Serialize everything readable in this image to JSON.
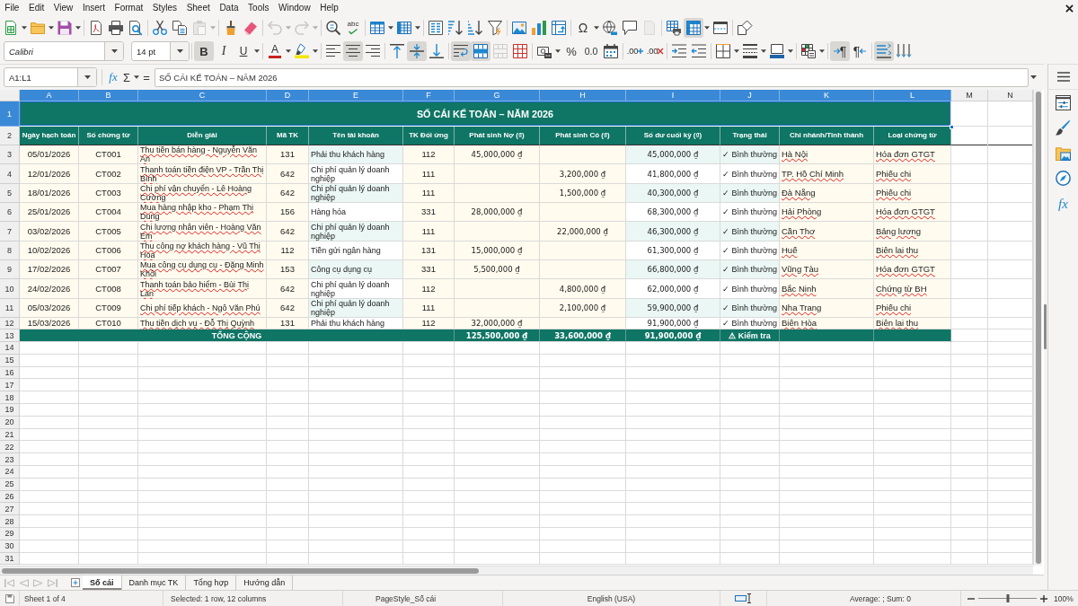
{
  "menu_bar": [
    "File",
    "Edit",
    "View",
    "Insert",
    "Format",
    "Styles",
    "Sheet",
    "Data",
    "Tools",
    "Window",
    "Help"
  ],
  "standard_toolbar": {
    "buttons": [
      {
        "pressed": false,
        "disabled": false
      },
      {
        "pressed": false,
        "disabled": false
      },
      {
        "pressed": false,
        "disabled": false
      },
      {
        "pressed": false,
        "disabled": false
      },
      {
        "pressed": false,
        "disabled": false
      },
      {
        "pressed": false,
        "disabled": false
      },
      {
        "pressed": false,
        "disabled": false
      },
      {
        "pressed": false,
        "disabled": false
      },
      {
        "pressed": false,
        "disabled": true
      },
      {
        "pressed": false,
        "disabled": false
      },
      {
        "pressed": false,
        "disabled": false
      },
      {
        "pressed": false,
        "disabled": true
      },
      {
        "pressed": false,
        "disabled": true
      },
      {
        "pressed": false,
        "disabled": false
      },
      {
        "label": "abc",
        "pressed": false,
        "disabled": false
      },
      {
        "pressed": false,
        "disabled": false
      },
      {
        "pressed": false,
        "disabled": false
      },
      {
        "pressed": false,
        "disabled": false
      },
      {
        "pressed": false,
        "disabled": false
      },
      {
        "pressed": false,
        "disabled": false
      },
      {
        "pressed": false,
        "disabled": false
      },
      {
        "pressed": false,
        "disabled": false
      },
      {
        "pressed": false,
        "disabled": false
      },
      {
        "pressed": false,
        "disabled": false
      },
      {
        "label": "Ω",
        "pressed": false,
        "disabled": false
      },
      {
        "pressed": false,
        "disabled": false
      },
      {
        "pressed": false,
        "disabled": false
      },
      {
        "pressed": false,
        "disabled": true
      },
      {
        "pressed": false,
        "disabled": false
      },
      {
        "pressed": true,
        "disabled": false
      },
      {
        "pressed": false,
        "disabled": false
      },
      {
        "pressed": false,
        "disabled": false
      }
    ]
  },
  "formatting_toolbar": {
    "font_name": "Calibri",
    "font_size": "14 pt",
    "buttons": [
      {
        "label": "B",
        "pressed": true,
        "disabled": false
      },
      {
        "label": "I",
        "pressed": false,
        "disabled": false
      },
      {
        "label": "U",
        "pressed": false,
        "disabled": false
      },
      {
        "label": "A",
        "pressed": false,
        "disabled": false
      },
      {
        "pressed": false,
        "disabled": false
      },
      {
        "pressed": false,
        "disabled": false
      },
      {
        "pressed": true,
        "disabled": false
      },
      {
        "pressed": false,
        "disabled": false
      },
      {
        "pressed": false,
        "disabled": false
      },
      {
        "pressed": true,
        "disabled": false
      },
      {
        "pressed": false,
        "disabled": false
      },
      {
        "pressed": true,
        "disabled": false
      },
      {
        "pressed": true,
        "disabled": false
      },
      {
        "pressed": false,
        "disabled": true
      },
      {
        "pressed": false,
        "disabled": false
      },
      {
        "pressed": false,
        "disabled": false
      },
      {
        "label": "%",
        "pressed": false,
        "disabled": false
      },
      {
        "label": "0.0",
        "pressed": false,
        "disabled": false
      },
      {
        "pressed": false,
        "disabled": false
      },
      {
        "label": ".00",
        "pressed": false,
        "disabled": false
      },
      {
        "label": ".00",
        "pressed": false,
        "disabled": false
      },
      {
        "pressed": false,
        "disabled": false
      },
      {
        "pressed": false,
        "disabled": false
      },
      {
        "pressed": false,
        "disabled": false
      },
      {
        "pressed": false,
        "disabled": false
      },
      {
        "pressed": false,
        "disabled": false
      },
      {
        "pressed": false,
        "disabled": false
      },
      {
        "label": "¶",
        "pressed": true,
        "disabled": false
      },
      {
        "label": "¶",
        "pressed": false,
        "disabled": false
      },
      {
        "pressed": true,
        "disabled": false
      },
      {
        "pressed": false,
        "disabled": false
      }
    ]
  },
  "formula_bar": {
    "name_box": "A1:L1",
    "function_wizard": "fx",
    "sum": "Σ",
    "formula_sign": "=",
    "content": "SỐ CÁI KẾ TOÁN – NĂM 2026"
  },
  "sheet": {
    "column_headers": [
      {
        "label": "A",
        "selected": true
      },
      {
        "label": "B",
        "selected": true
      },
      {
        "label": "C",
        "selected": true
      },
      {
        "label": "D",
        "selected": true
      },
      {
        "label": "E",
        "selected": true
      },
      {
        "label": "F",
        "selected": true
      },
      {
        "label": "G",
        "selected": true
      },
      {
        "label": "H",
        "selected": true
      },
      {
        "label": "I",
        "selected": true
      },
      {
        "label": "J",
        "selected": true
      },
      {
        "label": "K",
        "selected": true
      },
      {
        "label": "L",
        "selected": true
      },
      {
        "label": "M",
        "selected": false
      },
      {
        "label": "N",
        "selected": false
      }
    ],
    "row_headers": [
      {
        "label": "1",
        "selected": true
      },
      {
        "label": "2",
        "selected": false
      },
      {
        "label": "3",
        "selected": false
      },
      {
        "label": "4",
        "selected": false
      },
      {
        "label": "5",
        "selected": false
      },
      {
        "label": "6",
        "selected": false
      },
      {
        "label": "7",
        "selected": false
      },
      {
        "label": "8",
        "selected": false
      },
      {
        "label": "9",
        "selected": false
      },
      {
        "label": "10",
        "selected": false
      },
      {
        "label": "11",
        "selected": false
      },
      {
        "label": "12",
        "selected": false
      },
      {
        "label": "13",
        "selected": false
      },
      {
        "label": "14",
        "selected": false
      },
      {
        "label": "15",
        "selected": false
      },
      {
        "label": "16",
        "selected": false
      },
      {
        "label": "17",
        "selected": false
      },
      {
        "label": "18",
        "selected": false
      },
      {
        "label": "19",
        "selected": false
      },
      {
        "label": "20",
        "selected": false
      },
      {
        "label": "21",
        "selected": false
      },
      {
        "label": "22",
        "selected": false
      },
      {
        "label": "23",
        "selected": false
      },
      {
        "label": "24",
        "selected": false
      },
      {
        "label": "25",
        "selected": false
      },
      {
        "label": "26",
        "selected": false
      },
      {
        "label": "27",
        "selected": false
      },
      {
        "label": "28",
        "selected": false
      },
      {
        "label": "29",
        "selected": false
      },
      {
        "label": "30",
        "selected": false
      },
      {
        "label": "31",
        "selected": false
      }
    ],
    "title": {
      "text": "SỐ CÁI KẾ TOÁN – NĂM 2026",
      "selected": true
    },
    "table": {
      "columns": [
        {
          "heading": "Ngày hạch toán",
          "spell_flagged": false
        },
        {
          "heading": "Số chứng từ",
          "spell_flagged": false
        },
        {
          "heading": "Diễn giải",
          "spell_flagged": true
        },
        {
          "heading": "Mã TK",
          "spell_flagged": false
        },
        {
          "heading": "Tên tài khoản",
          "spell_flagged": false
        },
        {
          "heading": "TK Đối ứng",
          "spell_flagged": false
        },
        {
          "heading": "Phát sinh Nợ (₫)",
          "spell_flagged": false
        },
        {
          "heading": "Phát sinh Có (₫)",
          "spell_flagged": false
        },
        {
          "heading": "Số dư cuối kỳ (₫)",
          "spell_flagged": false
        },
        {
          "heading": "Trạng thái",
          "spell_flagged": false
        },
        {
          "heading": "Chi nhánh/Tỉnh thành",
          "spell_flagged": true
        },
        {
          "heading": "Loại chứng từ",
          "spell_flagged": true
        }
      ],
      "rows": [
        {
          "date": "05/01/2026",
          "voucher_no": "CT001",
          "description": "Thu tiền bán hàng - Nguyễn Văn An",
          "account": "131",
          "account_name": "Phải thu khách hàng",
          "contra_account": "112",
          "debit": "45,000,000 ₫",
          "balance": "45,000,000 ₫",
          "status": "✓ Bình thường",
          "branch": "Hà Nội",
          "voucher_type": "Hóa đơn GTGT"
        },
        {
          "date": "12/01/2026",
          "voucher_no": "CT002",
          "description": "Thanh toán tiền điện VP - Trần Thị Bình",
          "account": "642",
          "account_name": "Chi phí quản lý doanh nghiệp",
          "contra_account": "111",
          "credit": "3,200,000 ₫",
          "balance": "41,800,000 ₫",
          "status": "✓ Bình thường",
          "branch": "TP. Hồ Chí Minh",
          "voucher_type": "Phiếu chi"
        },
        {
          "date": "18/01/2026",
          "voucher_no": "CT003",
          "description": "Chi phí vận chuyển - Lê Hoàng Cường",
          "account": "642",
          "account_name": "Chi phí quản lý doanh nghiệp",
          "contra_account": "111",
          "credit": "1,500,000 ₫",
          "balance": "40,300,000 ₫",
          "status": "✓ Bình thường",
          "branch": "Đà Nẵng",
          "voucher_type": "Phiếu chi"
        },
        {
          "date": "25/01/2026",
          "voucher_no": "CT004",
          "description": "Mua hàng nhập kho - Phạm Thị Dung",
          "account": "156",
          "account_name": "Hàng hóa",
          "contra_account": "331",
          "debit": "28,000,000 ₫",
          "balance": "68,300,000 ₫",
          "status": "✓ Bình thường",
          "branch": "Hải Phòng",
          "voucher_type": "Hóa đơn GTGT"
        },
        {
          "date": "03/02/2026",
          "voucher_no": "CT005",
          "description": "Chi lương nhân viên - Hoàng Văn Em",
          "account": "642",
          "account_name": "Chi phí quản lý doanh nghiệp",
          "contra_account": "111",
          "credit": "22,000,000 ₫",
          "balance": "46,300,000 ₫",
          "status": "✓ Bình thường",
          "branch": "Cần Thơ",
          "voucher_type": "Bảng lương"
        },
        {
          "date": "10/02/2026",
          "voucher_no": "CT006",
          "description": "Thu công nợ khách hàng - Vũ Thị Hoa",
          "account": "112",
          "account_name": "Tiền gửi ngân hàng",
          "contra_account": "131",
          "debit": "15,000,000 ₫",
          "balance": "61,300,000 ₫",
          "status": "✓ Bình thường",
          "branch": "Huế",
          "voucher_type": "Biên lai thu"
        },
        {
          "date": "17/02/2026",
          "voucher_no": "CT007",
          "description": "Mua công cụ dụng cụ - Đặng Minh Khôi",
          "account": "153",
          "account_name": "Công cụ dụng cụ",
          "contra_account": "331",
          "debit": "5,500,000 ₫",
          "balance": "66,800,000 ₫",
          "status": "✓ Bình thường",
          "branch": "Vũng Tàu",
          "voucher_type": "Hóa đơn GTGT"
        },
        {
          "date": "24/02/2026",
          "voucher_no": "CT008",
          "description": "Thanh toán bảo hiểm - Bùi Thị Lan",
          "account": "642",
          "account_name": "Chi phí quản lý doanh nghiệp",
          "contra_account": "112",
          "credit": "4,800,000 ₫",
          "balance": "62,000,000 ₫",
          "status": "✓ Bình thường",
          "branch": "Bắc Ninh",
          "voucher_type": "Chứng từ BH"
        },
        {
          "date": "05/03/2026",
          "voucher_no": "CT009",
          "description": "Chi phí tiếp khách - Ngô Văn Phú",
          "account": "642",
          "account_name": "Chi phí quản lý doanh nghiệp",
          "contra_account": "111",
          "credit": "2,100,000 ₫",
          "balance": "59,900,000 ₫",
          "status": "✓ Bình thường",
          "branch": "Nha Trang",
          "voucher_type": "Phiếu chi"
        },
        {
          "date": "15/03/2026",
          "voucher_no": "CT010",
          "description": "Thu tiền dịch vụ - Đỗ Thị Quỳnh",
          "account": "131",
          "account_name": "Phải thu khách hàng",
          "contra_account": "112",
          "debit": "32,000,000 ₫",
          "balance": "91,900,000 ₫",
          "status": "✓ Bình thường",
          "branch": "Biên Hòa",
          "voucher_type": "Biên lai thu"
        }
      ],
      "totals": {
        "label": "TỔNG CỘNG",
        "debit": "125,500,000 ₫",
        "credit": "33,600,000 ₫",
        "balance": "91,900,000 ₫",
        "status": "⚠ Kiểm tra"
      }
    }
  },
  "sheet_tabs": [
    {
      "label": "Số cái",
      "selected": true
    },
    {
      "label": "Danh mục TK",
      "selected": false
    },
    {
      "label": "Tổng hợp",
      "selected": false
    },
    {
      "label": "Hướng dẫn",
      "selected": false
    }
  ],
  "sidebar": {
    "functions_button": "fx"
  },
  "status_bar": {
    "sheet_position": "Sheet 1 of 4",
    "selection": "Selected: 1 row, 12 columns",
    "page_style": "PageStyle_Số cái",
    "language": "English (USA)",
    "statistics": "Average: ; Sum: 0",
    "zoom_slider": {
      "level": 0.5
    },
    "zoom": "100%"
  }
}
